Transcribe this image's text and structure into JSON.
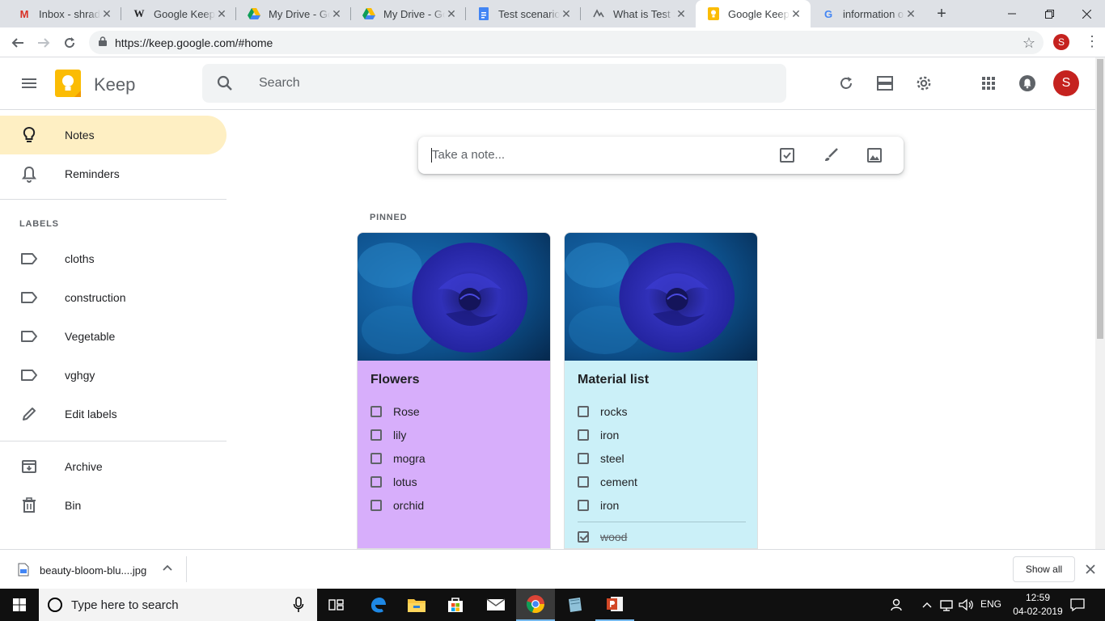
{
  "browser": {
    "tabs": [
      {
        "title": "Inbox - shradd",
        "icon": "gmail-icon",
        "active": false
      },
      {
        "title": "Google Keep - ",
        "icon": "wikipedia-icon",
        "active": false
      },
      {
        "title": "My Drive - Go",
        "icon": "drive-icon",
        "active": false
      },
      {
        "title": "My Drive - Go",
        "icon": "drive-icon",
        "active": false
      },
      {
        "title": "Test scenario - ",
        "icon": "docs-icon",
        "active": false
      },
      {
        "title": "What is Test Sc",
        "icon": "globe-icon",
        "active": false
      },
      {
        "title": "Google Keep",
        "icon": "keep-icon",
        "active": true
      },
      {
        "title": "information of",
        "icon": "google-icon",
        "active": false
      }
    ],
    "new_tab": "+",
    "url": "https://keep.google.com/#home",
    "profile_initial": "S"
  },
  "app": {
    "name": "Keep",
    "search_placeholder": "Search",
    "account_initial": "S"
  },
  "sidebar": {
    "items": [
      {
        "label": "Notes",
        "icon": "bulb-icon"
      },
      {
        "label": "Reminders",
        "icon": "bell-icon"
      }
    ],
    "labels_heading": "LABELS",
    "labels": [
      {
        "label": "cloths"
      },
      {
        "label": "construction"
      },
      {
        "label": "Vegetable"
      },
      {
        "label": "vghgy"
      }
    ],
    "edit_labels": "Edit labels",
    "archive": "Archive",
    "bin": "Bin"
  },
  "main": {
    "take_note_placeholder": "Take a note...",
    "pinned_heading": "PINNED",
    "notes": [
      {
        "title": "Flowers",
        "color": "#d7aefb",
        "items": [
          {
            "text": "Rose",
            "checked": false
          },
          {
            "text": "lily",
            "checked": false
          },
          {
            "text": "mogra",
            "checked": false
          },
          {
            "text": "lotus",
            "checked": false
          },
          {
            "text": "orchid",
            "checked": false
          }
        ]
      },
      {
        "title": "Material list",
        "color": "#cbf0f8",
        "items": [
          {
            "text": "rocks",
            "checked": false
          },
          {
            "text": "iron",
            "checked": false
          },
          {
            "text": "steel",
            "checked": false
          },
          {
            "text": "cement",
            "checked": false
          },
          {
            "text": "iron",
            "checked": false
          },
          {
            "text": "wood",
            "checked": true
          }
        ]
      }
    ]
  },
  "downloads": {
    "file_name": "beauty-bloom-blu....jpg",
    "show_all": "Show all"
  },
  "taskbar": {
    "search_placeholder": "Type here to search",
    "language": "ENG",
    "time": "12:59",
    "date": "04-02-2019"
  },
  "colors": {
    "keep_yellow": "#fbbc04",
    "active_nav": "#feefc3",
    "avatar_red": "#c5221f"
  }
}
